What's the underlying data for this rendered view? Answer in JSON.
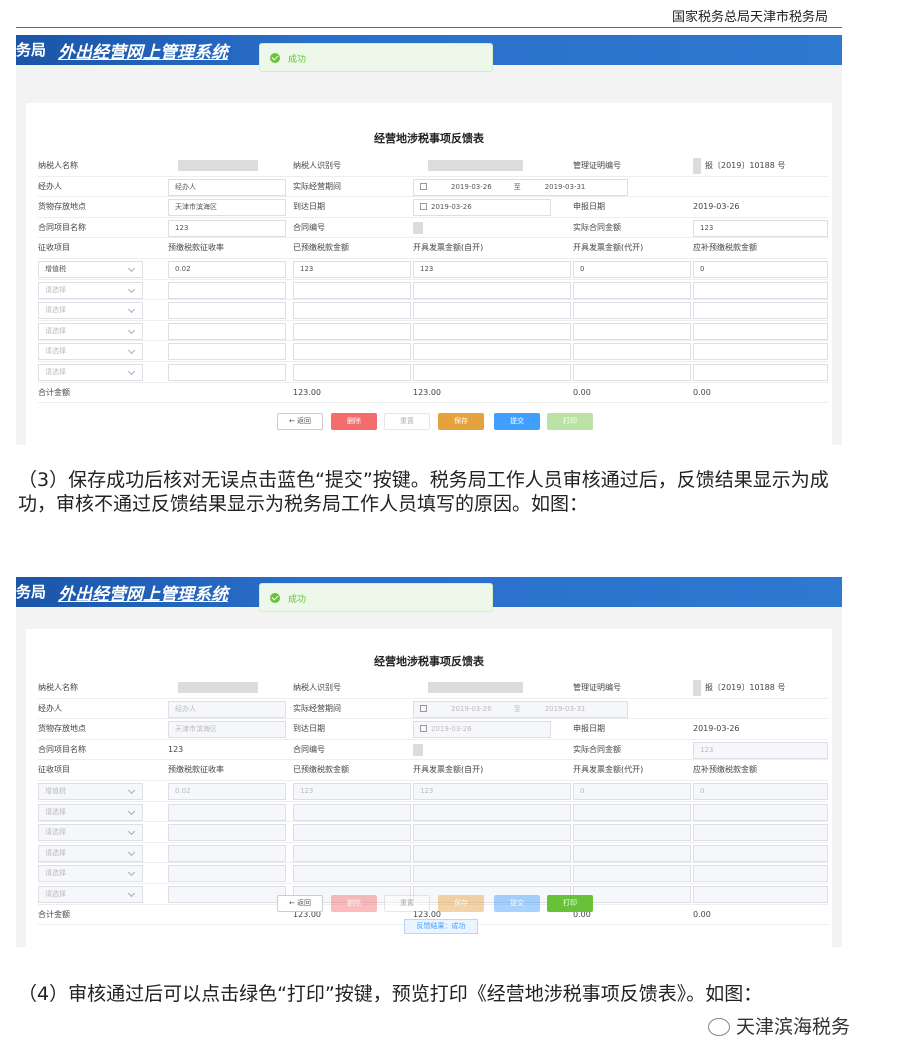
{
  "header": {
    "org": "国家税务总局天津市税务局"
  },
  "banner": {
    "brand": "务局",
    "system": "外出经营网上管理系统"
  },
  "toast": {
    "text": "成功"
  },
  "form": {
    "title": "经营地涉税事项反馈表",
    "labels": {
      "taxpayer_name": "纳税人名称",
      "taxpayer_id": "纳税人识别号",
      "cert_no": "管理证明编号",
      "agent": "经办人",
      "period": "实际经营期间",
      "storage": "货物存放地点",
      "arrive": "到达日期",
      "apply": "申报日期",
      "contract_name": "合同项目名称",
      "contract_no": "合同编号",
      "contract_amount": "实际合同金额",
      "levy": "征收项目",
      "rate": "预缴税款征收率",
      "prepaid": "已预缴税款金额",
      "self_invoice": "开具发票金额(自开)",
      "agent_invoice": "开具发票金额(代开)",
      "supplement": "应补预缴税款金额",
      "total": "合计金额"
    },
    "values": {
      "cert_no": "报〔2019〕10188 号",
      "agent": "经办人",
      "period_from": "2019-03-26",
      "period_sep": "至",
      "period_to": "2019-03-31",
      "storage": "天津市滨海区",
      "arrive": "2019-03-26",
      "apply": "2019-03-26",
      "contract_name": "123",
      "contract_amount": "123"
    },
    "levy_row": {
      "item": "增值税",
      "rate": "0.02",
      "prepaid": "123",
      "self_invoice": "123",
      "agent_invoice": "0",
      "supplement": "0"
    },
    "placeholder": "请选择",
    "totals": {
      "prepaid": "123.00",
      "self_invoice": "123.00",
      "agent_invoice": "0.00",
      "supplement": "0.00"
    }
  },
  "buttons": {
    "back": "← 返回",
    "delete": "删除",
    "reset": "重置",
    "save": "保存",
    "submit": "提交",
    "print": "打印"
  },
  "feedback": "反馈结果：成功",
  "paragraphs": {
    "p3": "（3）保存成功后核对无误点击蓝色“提交”按键。税务局工作人员审核通过后，反馈结果显示为成功，审核不通过反馈结果显示为税务局工作人员填写的原因。如图：",
    "p4": "（4）审核通过后可以点击绿色“打印”按键，预览打印《经营地涉税事项反馈表》。如图："
  },
  "watermark": "天津滨海税务",
  "colors": {
    "banner": "#2a6fc9",
    "success": "#67c23a",
    "danger": "#f56c6c",
    "warning": "#e6a23c",
    "primary": "#409eff"
  }
}
